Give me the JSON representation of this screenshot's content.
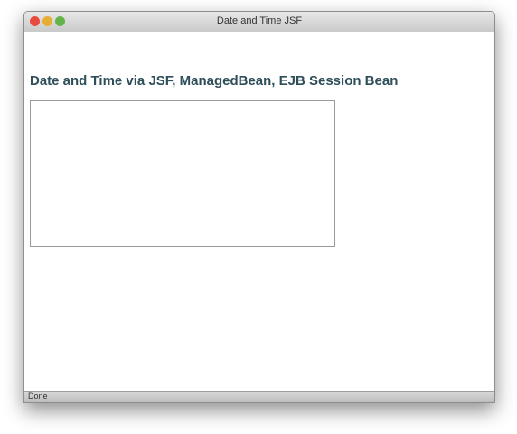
{
  "window": {
    "title": "Date and Time JSF"
  },
  "page": {
    "heading": "Date and Time via JSF, ManagedBean, EJB Session Bean"
  },
  "status": {
    "text": "Done"
  }
}
